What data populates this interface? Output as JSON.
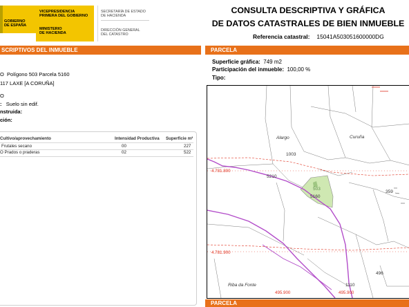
{
  "header": {
    "gov_lines": [
      "GOBIERNO",
      "DE ESPAÑA"
    ],
    "ministry_lines": [
      "VICEPRESIDENCIA",
      "PRIMERA DEL GOBIERNO",
      "",
      "MINISTERIO",
      "DE HACIENDA"
    ],
    "dgc_lines": [
      "SECRETARÍA DE ESTADO",
      "DE HACIENDA",
      "DIRECCIÓN GENERAL",
      "DEL CATASTRO"
    ],
    "title_line1": "CONSULTA DESCRIPTIVA Y GRÁFICA",
    "title_line2": "DE DATOS CATASTRALES DE BIEN INMUEBLE",
    "ref_label": "Referencia catastral:",
    "ref_value": "15041A503051600000DG"
  },
  "left": {
    "bar_title": "SCRIPTIVOS DEL INMUEBLE",
    "loc_prefix": "O",
    "location": "Polígono 503 Parcela 5160",
    "address": "117 LAXE [A CORUÑA]",
    "clase_frag": "O",
    "uso_label_frag": ":",
    "uso_value": "Suelo sin edif.",
    "construida_label": "nstruida:",
    "construccion_label": "ción:",
    "crops": {
      "col_cultivo": "Cultivo/aprovechamiento",
      "col_intensidad": "Intensidad Productiva",
      "col_superficie": "Superficie m²",
      "rows": [
        {
          "cultivo": "Frutales secano",
          "intensidad": "00",
          "superficie": "227"
        },
        {
          "cultivo": "O Prados o praderas",
          "intensidad": "02",
          "superficie": "522"
        }
      ]
    }
  },
  "right": {
    "bar_title": "PARCELA",
    "superficie_label": "Superficie gráfica:",
    "superficie_value": "749 m2",
    "participacion_label": "Participación del inmueble:",
    "participacion_value": "100,00 %",
    "tipo_label": "Tipo:",
    "bottom_bar_title": "PARCELA"
  },
  "map": {
    "place_labels": [
      "Alargo",
      "Curuña",
      "Riba da Fonte"
    ],
    "parcel_numbers": [
      "1003",
      "5210",
      "503",
      "5160",
      "359",
      "496",
      "1110"
    ],
    "coord_labels": [
      "4.781.800",
      "4.781.900",
      "495.900",
      "495.900"
    ],
    "colors": {
      "highlight_fill": "#cfe8b2",
      "road": "#b24cc9",
      "grid": "#e0301e",
      "coord_text": "#e0301e"
    }
  }
}
